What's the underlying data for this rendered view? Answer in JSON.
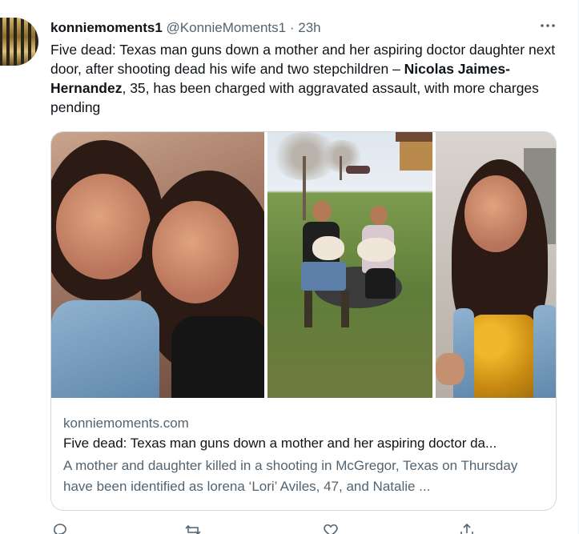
{
  "tweet": {
    "display_name": "konniemoments1",
    "handle": "@KonnieMoments1",
    "separator": "·",
    "time": "23h",
    "more_icon": "more-horizontal-icon",
    "text_before": "Five dead: Texas man guns down a mother and her aspiring doctor daughter next door, after shooting dead his wife and two stepchildren – ",
    "text_bold": "Nicolas Jaimes-Hernandez",
    "text_after": ", 35, has been charged with aggravated assault, with more charges pending"
  },
  "card": {
    "domain": "konniemoments.com",
    "title": "Five dead: Texas man guns down a mother and her aspiring doctor da...",
    "description": "A mother and daughter killed in a shooting in McGregor, Texas on Thursday have been identified as lorena ‘Lori’ Aviles, 47, and Natalie ..."
  },
  "actions": {
    "icons": [
      "reply-icon",
      "retweet-icon",
      "like-icon",
      "share-icon"
    ]
  },
  "colors": {
    "text": "#0f1419",
    "secondary": "#536471",
    "border": "#cfd9de"
  }
}
